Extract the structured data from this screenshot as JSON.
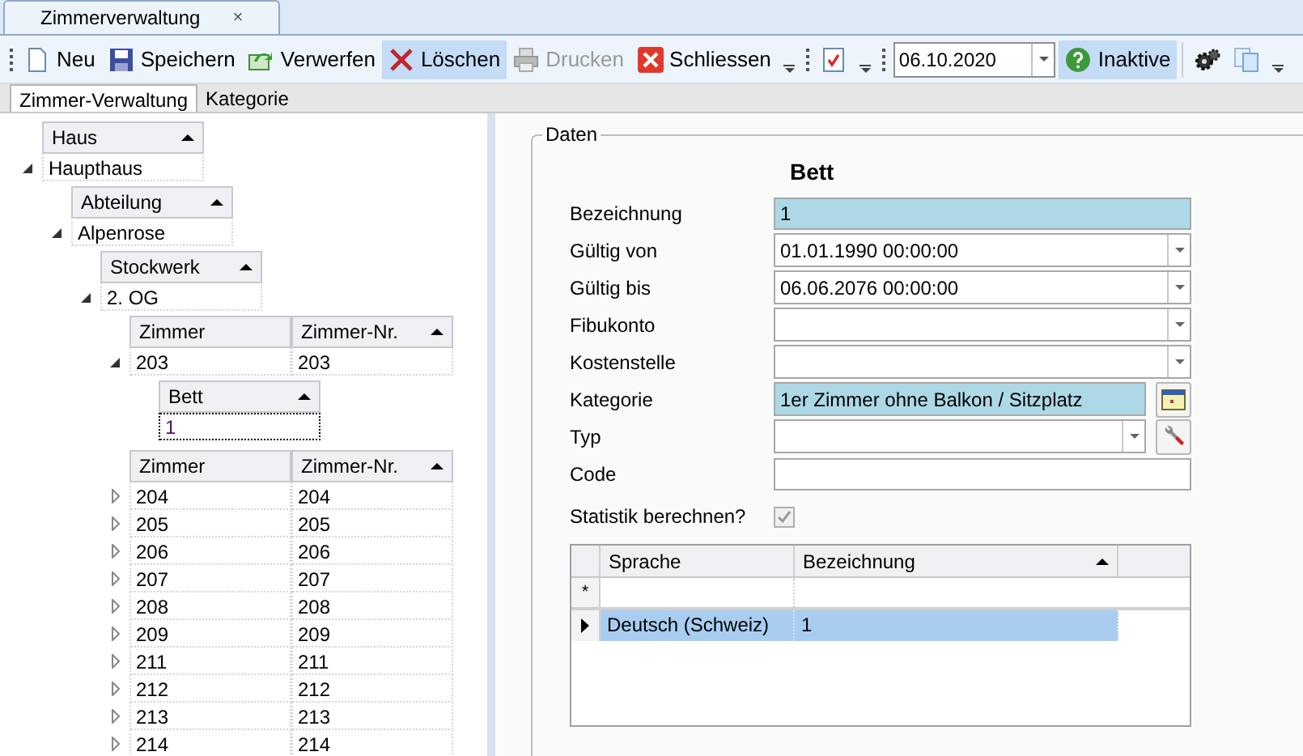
{
  "doc_tab": {
    "title": "Zimmerverwaltung",
    "close": "×"
  },
  "toolbar": [
    {
      "kind": "grip"
    },
    {
      "kind": "button",
      "label": "Neu",
      "disabled": false,
      "hovered": false
    },
    {
      "kind": "button",
      "label": "Speichern",
      "disabled": false,
      "hovered": false
    },
    {
      "kind": "button",
      "label": "Verwerfen",
      "disabled": false,
      "hovered": false
    },
    {
      "kind": "button",
      "label": "Löschen",
      "disabled": false,
      "hovered": true
    },
    {
      "kind": "button",
      "label": "Drucken",
      "disabled": true,
      "hovered": false
    },
    {
      "kind": "button",
      "label": "Schliessen",
      "disabled": false,
      "hovered": false
    },
    {
      "kind": "overflow"
    },
    {
      "kind": "grip"
    },
    {
      "kind": "icon_button"
    },
    {
      "kind": "overflow"
    },
    {
      "kind": "grip"
    },
    {
      "kind": "date",
      "value": "06.10.2020"
    },
    {
      "kind": "button",
      "label": "Inaktive",
      "disabled": false,
      "hovered": true
    },
    {
      "kind": "separator"
    },
    {
      "kind": "icon_button"
    },
    {
      "kind": "icon_button"
    },
    {
      "kind": "overflow"
    }
  ],
  "tabs": [
    {
      "label": "Zimmer-Verwaltung",
      "selected": true
    },
    {
      "label": "Kategorie",
      "selected": false
    }
  ],
  "tree": [
    {
      "columns": [
        "Haus"
      ],
      "rows": [
        {
          "cells": [
            "Haupthaus"
          ],
          "expanded": true,
          "focused": false,
          "children": [
            {
              "columns": [
                "Abteilung"
              ],
              "rows": [
                {
                  "cells": [
                    "Alpenrose"
                  ],
                  "expanded": true,
                  "focused": false,
                  "children": [
                    {
                      "columns": [
                        "Stockwerk"
                      ],
                      "rows": [
                        {
                          "cells": [
                            "2. OG"
                          ],
                          "expanded": true,
                          "focused": false,
                          "children": [
                            {
                              "columns": [
                                "Zimmer",
                                "Zimmer-Nr."
                              ],
                              "rows": [
                                {
                                  "cells": [
                                    "203",
                                    "203"
                                  ],
                                  "expanded": true,
                                  "focused": false,
                                  "children": [
                                    {
                                      "columns": [
                                        "Bett"
                                      ],
                                      "rows": [
                                        {
                                          "cells": [
                                            "1"
                                          ],
                                          "focused": true,
                                          "leaf": true
                                        }
                                      ]
                                    }
                                  ]
                                }
                              ]
                            },
                            {
                              "columns": [
                                "Zimmer",
                                "Zimmer-Nr."
                              ],
                              "rows": [
                                {
                                  "cells": [
                                    "204",
                                    "204"
                                  ],
                                  "expanded": false,
                                  "focused": false
                                },
                                {
                                  "cells": [
                                    "205",
                                    "205"
                                  ],
                                  "expanded": false,
                                  "focused": false
                                },
                                {
                                  "cells": [
                                    "206",
                                    "206"
                                  ],
                                  "expanded": false,
                                  "focused": false
                                },
                                {
                                  "cells": [
                                    "207",
                                    "207"
                                  ],
                                  "expanded": false,
                                  "focused": false
                                },
                                {
                                  "cells": [
                                    "208",
                                    "208"
                                  ],
                                  "expanded": false,
                                  "focused": false
                                },
                                {
                                  "cells": [
                                    "209",
                                    "209"
                                  ],
                                  "expanded": false,
                                  "focused": false
                                },
                                {
                                  "cells": [
                                    "211",
                                    "211"
                                  ],
                                  "expanded": false,
                                  "focused": false
                                },
                                {
                                  "cells": [
                                    "212",
                                    "212"
                                  ],
                                  "expanded": false,
                                  "focused": false
                                },
                                {
                                  "cells": [
                                    "213",
                                    "213"
                                  ],
                                  "expanded": false,
                                  "focused": false
                                },
                                {
                                  "cells": [
                                    "214",
                                    "214"
                                  ],
                                  "expanded": false,
                                  "focused": false
                                }
                              ]
                            }
                          ]
                        }
                      ]
                    }
                  ]
                }
              ]
            }
          ]
        }
      ]
    }
  ],
  "details": {
    "group_title": "Daten",
    "heading": "Bett",
    "fields": [
      {
        "label": "Bezeichnung",
        "kind": "text",
        "value": "1",
        "highlighted": true
      },
      {
        "label": "Gültig von",
        "kind": "combo",
        "value": "01.01.1990 00:00:00",
        "highlighted": false
      },
      {
        "label": "Gültig bis",
        "kind": "combo",
        "value": "06.06.2076 00:00:00",
        "highlighted": false
      },
      {
        "label": "Fibukonto",
        "kind": "combo",
        "highlighted": false
      },
      {
        "label": "Kostenstelle",
        "kind": "combo",
        "highlighted": false
      },
      {
        "label": "Kategorie",
        "kind": "lookup",
        "value": "1er Zimmer ohne Balkon / Sitzplatz",
        "highlighted": true
      },
      {
        "label": "Typ",
        "kind": "combo_tool",
        "highlighted": false
      },
      {
        "label": "Code",
        "kind": "text",
        "highlighted": false
      }
    ],
    "checkbox": {
      "label": "Statistik berechnen?",
      "checked": true,
      "disabled": true
    },
    "grid": {
      "columns": [
        "Sprache",
        "Bezeichnung"
      ],
      "new_row_marker": "*",
      "rows": [
        {
          "cells": [
            "Deutsch (Schweiz)",
            "1"
          ],
          "selected": true
        }
      ]
    }
  }
}
